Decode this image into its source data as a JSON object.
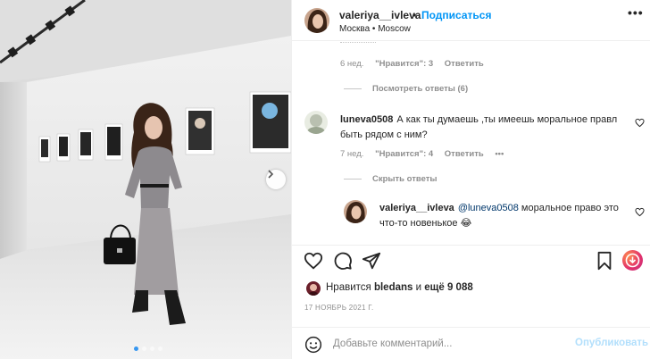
{
  "post": {
    "username": "valeriya__ivleva",
    "separator": "•",
    "follow_label": "Подписаться",
    "location": "Москва • Moscow",
    "more_label": "•••"
  },
  "comments": {
    "prev_meta": {
      "age": "6 нед.",
      "likes": "\"Нравится\": 3",
      "reply": "Ответить"
    },
    "view_replies": "Посмотреть ответы (6)",
    "main": {
      "username": "luneva0508",
      "text_line1": "А как ты думаешь ,ты имеешь моральное правл",
      "text_line2": "быть рядом с ним?",
      "age": "7 нед.",
      "likes": "\"Нравится\": 4",
      "reply": "Ответить",
      "more": "•••"
    },
    "hide_replies": "Скрыть ответы",
    "reply": {
      "username": "valeriya__ivleva",
      "mention": "@luneva0508",
      "text_line1": " моральное право это",
      "text_line2": "что-то новенькое 😂"
    }
  },
  "likes": {
    "prefix": "Нравится",
    "user": "bledans",
    "suffix": "и",
    "count": "ещё 9 088"
  },
  "date": "17 НОЯБРЬ 2021 Г.",
  "add_comment": {
    "placeholder": "Добавьте комментарий...",
    "publish_label": "Опубликовать"
  },
  "icons": {
    "heart": "heart-icon",
    "comment": "comment-icon",
    "share": "paper-plane-icon",
    "save": "bookmark-icon",
    "emoji": "smiley-icon",
    "next": "chevron-right-icon"
  },
  "carousel": {
    "total": 4,
    "active": 1
  },
  "colors": {
    "accent": "#0095f6",
    "text": "#262626",
    "muted": "#8e8e8e",
    "publish_disabled": "#b2dffc"
  }
}
